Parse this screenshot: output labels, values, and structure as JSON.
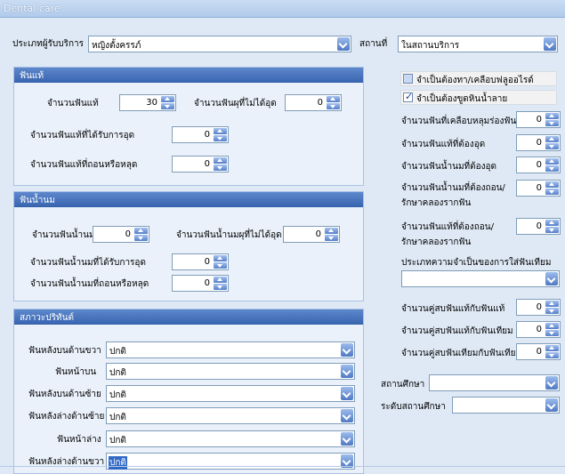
{
  "window": {
    "title": "Dental care"
  },
  "top": {
    "service_label": "ประเภทผู้รับบริการ",
    "service_value": "หญิงตั้งครรภ์",
    "place_label": "สถานที่",
    "place_value": "ในสถานบริการ"
  },
  "permanent": {
    "title": "ฟันแท้",
    "count_label": "จำนวนฟันแท้",
    "count_value": "30",
    "unfilled_label": "จำนวนฟันผุที่ไม่ได้อุด",
    "unfilled_value": "0",
    "filled_label": "จำนวนฟันแท้ที่ได้รับการอุด",
    "filled_value": "0",
    "extracted_label": "จำนวนฟันแท้ที่ถอนหรือหลุด",
    "extracted_value": "0"
  },
  "milk": {
    "title": "ฟันน้ำนม",
    "count_label": "จำนวนฟันน้ำนม",
    "count_value": "0",
    "unfilled_label": "จำนวนฟันน้ำนมผุที่ไม่ได้อุด",
    "unfilled_value": "0",
    "filled_label": "จำนวนฟันน้ำนมที่ได้รับการอุด",
    "filled_value": "0",
    "extracted_label": "จำนวนฟันน้ำนมที่ถอนหรือหลุด",
    "extracted_value": "0"
  },
  "periodontal": {
    "title": "สภาวะปริทันต์",
    "rows": [
      {
        "label": "ฟันหลังบนด้านขวา",
        "value": "ปกติ"
      },
      {
        "label": "ฟันหน้าบน",
        "value": "ปกติ"
      },
      {
        "label": "ฟันหลังบนด้านซ้าย",
        "value": "ปกติ"
      },
      {
        "label": "ฟันหลังล่างด้านซ้าย",
        "value": "ปกติ"
      },
      {
        "label": "ฟันหน้าล่าง",
        "value": "ปกติ"
      },
      {
        "label": "ฟันหลังล่างด้านขวา",
        "value": "ปกติ"
      }
    ]
  },
  "right": {
    "fluoride_label": "จำเป็นต้องทา/เคลือบฟลูออไรด์",
    "fluoride_checked": false,
    "scaling_label": "จำเป็นต้องขูดหินน้ำลาย",
    "scaling_checked": true,
    "sealant_label": "จำนวนฟันที่เคลือบหลุมร่องฟัน",
    "sealant_value": "0",
    "perm_fill_label": "จำนวนฟันแท้ที่ต้องอุด",
    "perm_fill_value": "0",
    "milk_fill_label": "จำนวนฟันน้ำนมที่ต้องอุด",
    "milk_fill_value": "0",
    "milk_root_label_1": "จำนวนฟันน้ำนมที่ต้องถอน/",
    "milk_root_label_2": "รักษาคลองรากฟัน",
    "milk_root_value": "0",
    "perm_root_label_1": "จำนวนฟันแท้ที่ต้องถอน/",
    "perm_root_label_2": "รักษาคลองรากฟัน",
    "perm_root_value": "0",
    "denture_need_label": "ประเภทความจำเป็นของการใส่ฟันเทียม",
    "denture_need_value": "",
    "pair_perm_label": "จำนวนคู่สบฟันแท้กับฟันแท้",
    "pair_perm_value": "0",
    "pair_mixed_label": "จำนวนคู่สบฟันแท้กับฟันเทียม",
    "pair_mixed_value": "0",
    "pair_denture_label": "จำนวนคู่สบฟันเทียมกับฟันเทียม",
    "pair_denture_value": "0",
    "school_label": "สถานศึกษา",
    "school_value": "",
    "school_level_label": "ระดับสถานศึกษา",
    "school_level_value": ""
  }
}
